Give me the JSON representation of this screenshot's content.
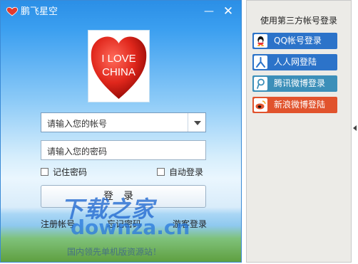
{
  "window": {
    "title": "鹏飞星空",
    "minimize": "—",
    "close": "✕"
  },
  "avatar": {
    "line1": "I LOVE",
    "line2": "CHINA"
  },
  "form": {
    "account_value": "请输入您的帐号",
    "password_value": "请输入您的密码",
    "remember_label": "记住密码",
    "autologin_label": "自动登录",
    "login_label": "登录"
  },
  "links": {
    "register": "注册帐号",
    "forgot": "忘记密码",
    "guest": "游客登录"
  },
  "watermark": {
    "line1": "下载之家",
    "line2": "downza.cn"
  },
  "footer": "国内领先单机版资源站！",
  "side": {
    "title": "使用第三方帐号登录",
    "buttons": [
      {
        "label": "QQ帐号登录",
        "icon": "qq-icon",
        "color": "#2c73c9"
      },
      {
        "label": "人人网登陆",
        "icon": "renren-icon",
        "color": "#2c73c9"
      },
      {
        "label": "腾讯微博登录",
        "icon": "tencent-weibo-icon",
        "color": "#3c8fb9"
      },
      {
        "label": "新浪微博登陆",
        "icon": "sina-weibo-icon",
        "color": "#e1532d"
      }
    ]
  }
}
